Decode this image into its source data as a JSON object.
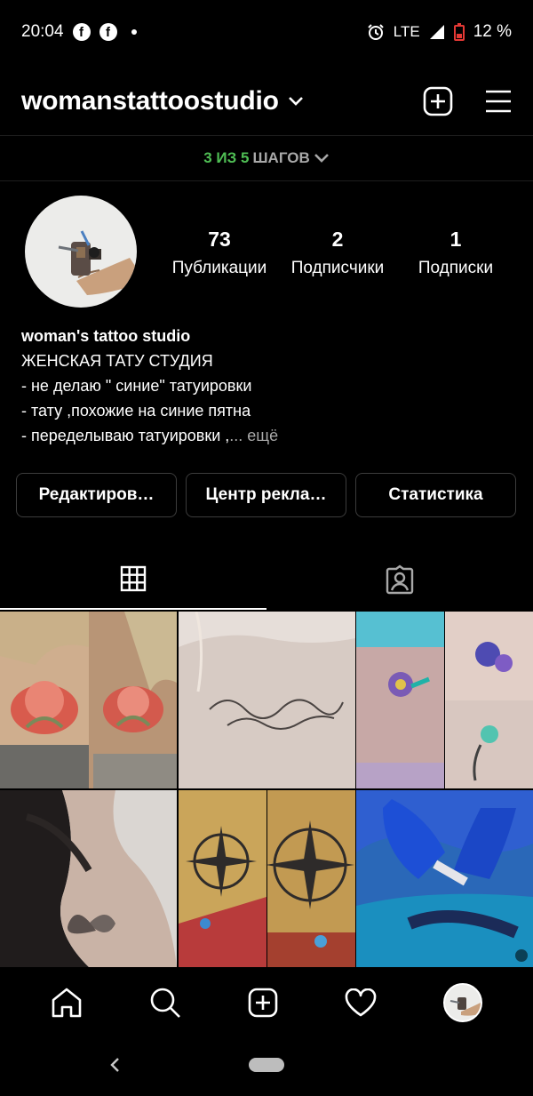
{
  "status_bar": {
    "time": "20:04",
    "network": "LTE",
    "battery": "12 %"
  },
  "header": {
    "username": "womanstattoostudio"
  },
  "onboarding": {
    "progress": "3 ИЗ 5",
    "label": "ШАГОВ"
  },
  "profile": {
    "stats": [
      {
        "value": "73",
        "label": "Публикации"
      },
      {
        "value": "2",
        "label": "Подписчики"
      },
      {
        "value": "1",
        "label": "Подписки"
      }
    ],
    "bio": {
      "name": "woman's tattoo studio",
      "lines": [
        "ЖЕНСКАЯ ТАТУ СТУДИЯ",
        "- не делаю \" синие\" татуировки",
        "- тату ,похожие на синие пятна",
        "- переделываю  татуировки ,"
      ],
      "more": "... ещё"
    }
  },
  "buttons": {
    "edit": "Редактиров…",
    "ads": "Центр рекла…",
    "stats": "Статистика"
  },
  "grid": {
    "posts": [
      {
        "subject": "lotus-back-tattoo"
      },
      {
        "subject": "script-shoulder-tattoo"
      },
      {
        "subject": "flower-hummingbird-tattoo"
      },
      {
        "subject": "moth-hip-tattoo"
      },
      {
        "subject": "compass-forearm-tattoo"
      },
      {
        "subject": "blue-gloves-tattooing"
      }
    ]
  },
  "icons": {
    "new_post": "plus-square-icon",
    "menu": "hamburger-menu-icon",
    "grid_tab": "grid-icon",
    "tagged_tab": "tagged-person-icon",
    "nav": [
      "home-icon",
      "search-icon",
      "plus-square-icon",
      "heart-icon",
      "profile-avatar"
    ]
  }
}
